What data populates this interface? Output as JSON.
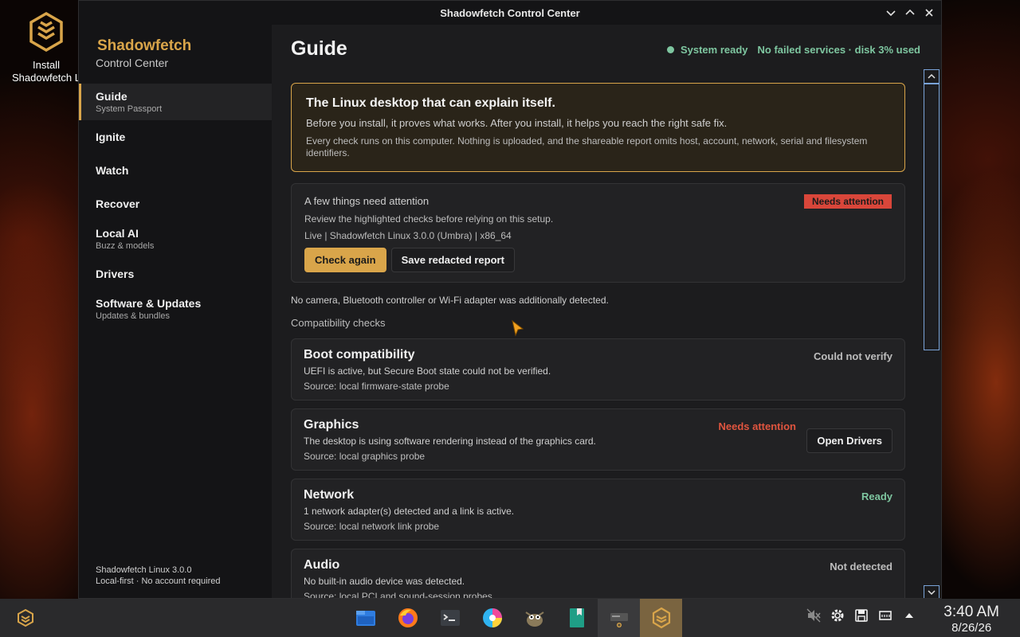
{
  "desktop": {
    "install_icon_label_line1": "Install",
    "install_icon_label_line2": "Shadowfetch L"
  },
  "window": {
    "title": "Shadowfetch Control Center"
  },
  "sidebar": {
    "brand_name": "Shadowfetch",
    "brand_sub": "Control Center",
    "items": [
      {
        "label": "Guide",
        "sub": "System Passport",
        "active": true
      },
      {
        "label": "Ignite",
        "sub": ""
      },
      {
        "label": "Watch",
        "sub": ""
      },
      {
        "label": "Recover",
        "sub": ""
      },
      {
        "label": "Local AI",
        "sub": "Buzz & models"
      },
      {
        "label": "Drivers",
        "sub": ""
      },
      {
        "label": "Software & Updates",
        "sub": "Updates & bundles"
      }
    ],
    "footer_line1": "Shadowfetch Linux 3.0.0",
    "footer_line2": "Local-first · No account required"
  },
  "main": {
    "page_title": "Guide",
    "status_ready": "System ready",
    "status_detail": "No failed services · disk 3% used",
    "hero": {
      "heading": "The Linux desktop that can explain itself.",
      "line1": "Before you install, it proves what works. After you install, it helps you reach the right safe fix.",
      "line2": "Every check runs on this computer. Nothing is uploaded, and the shareable report omits host, account, network, serial and filesystem identifiers."
    },
    "attention": {
      "heading": "A few things need attention",
      "badge": "Needs attention",
      "text": "Review the highlighted checks before relying on this setup.",
      "system": "Live | Shadowfetch Linux 3.0.0 (Umbra) | x86_64",
      "check_again": "Check again",
      "save_report": "Save redacted report"
    },
    "note": "No camera, Bluetooth controller or Wi-Fi adapter was additionally detected.",
    "section_label": "Compatibility checks",
    "checks": [
      {
        "title": "Boot compatibility",
        "desc": "UEFI is active, but Secure Boot state could not be verified.",
        "source": "Source: local firmware-state probe",
        "status": "Could not verify"
      },
      {
        "title": "Graphics",
        "desc": "The desktop is using software rendering instead of the graphics card.",
        "source": "Source: local graphics probe",
        "status": "Needs attention",
        "action": "Open Drivers"
      },
      {
        "title": "Network",
        "desc": "1 network adapter(s) detected and a link is active.",
        "source": "Source: local network link probe",
        "status": "Ready"
      },
      {
        "title": "Audio",
        "desc": "No built-in audio device was detected.",
        "source": "Source: local PCI and sound-session probes",
        "status": "Not detected"
      }
    ]
  },
  "taskbar": {
    "time": "3:40 AM",
    "date": "8/26/26"
  },
  "colors": {
    "accent": "#d9a54a",
    "ready": "#7ec6a0",
    "danger": "#e0553f",
    "scroll": "#7aa3d8"
  }
}
